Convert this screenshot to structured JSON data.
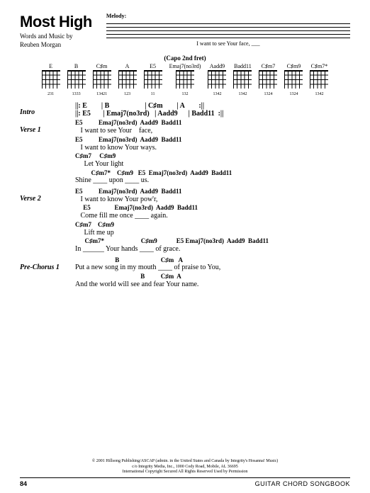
{
  "title": "Most High",
  "byline_label": "Words and Music by",
  "byline_author": "Reuben Morgan",
  "melody_label": "Melody:",
  "melody_lyric": "I    want   to    see    Your   face, ___",
  "capo": "(Capo 2nd fret)",
  "chord_charts": [
    {
      "name": "E",
      "fing": "231"
    },
    {
      "name": "B",
      "fing": "1333"
    },
    {
      "name": "C♯m",
      "fing": "13421"
    },
    {
      "name": "A",
      "fing": "123"
    },
    {
      "name": "E5",
      "fing": "11"
    },
    {
      "name": "Emaj7(no3rd)",
      "fing": "132"
    },
    {
      "name": "Aadd9",
      "fing": "1342"
    },
    {
      "name": "Badd11",
      "fing": "1342"
    },
    {
      "name": "C♯m7",
      "fing": "1324"
    },
    {
      "name": "C♯m9",
      "fing": "1324"
    },
    {
      "name": "C♯m7*",
      "fing": "1342"
    }
  ],
  "intro": [
    "||: E        | B                    | C♯m        | A        :||",
    "||: E5       | Emaj7(no3rd)   | Aadd9      | Badd11  :||"
  ],
  "verse1": [
    {
      "c": "E5          Emaj7(no3rd)  Aadd9  Badd11",
      "l": "   I want to see Your    face,"
    },
    {
      "c": "E5          Emaj7(no3rd)  Aadd9  Badd11",
      "l": "   I want to know Your ways."
    },
    {
      "c": "C♯m7     C♯m9",
      "l": "     Let Your light"
    },
    {
      "c": "          C♯m7*    C♯m9   E5  Emaj7(no3rd)  Aadd9  Badd11",
      "l": "Shine ____ upon ____ us."
    }
  ],
  "verse2": [
    {
      "c": "E5          Emaj7(no3rd)  Aadd9  Badd11",
      "l": "   I want to know Your pow'r,"
    },
    {
      "c": "     E5               Emaj7(no3rd)  Aadd9  Badd11",
      "l": "   Come fill me once ____ again."
    },
    {
      "c": "C♯m7    C♯m9",
      "l": "     Lift me up"
    },
    {
      "c": "      C♯m7*                       C♯m9            E5 Emaj7(no3rd)  Aadd9  Badd11",
      "l": "In ______ Your hands ____ of grace."
    }
  ],
  "prechorus1": [
    {
      "c": "                         B                          C♯m   A",
      "l": "Put a new song in my mouth ____ of praise to You,"
    },
    {
      "c": "                                         B          C♯m  A",
      "l": "And the world will see and fear Your name."
    }
  ],
  "copyright": [
    "© 2001 Hillsong Publishing/ASCAP (admin. in the United States and Canada by Integrity's Hosanna! Music)",
    "c/o Integrity Media, Inc., 1000 Cody Road, Mobile, AL 36695",
    "International Copyright Secured  All Rights Reserved  Used by Permission"
  ],
  "page_number": "84",
  "book_title": "GUITAR CHORD SONGBOOK"
}
